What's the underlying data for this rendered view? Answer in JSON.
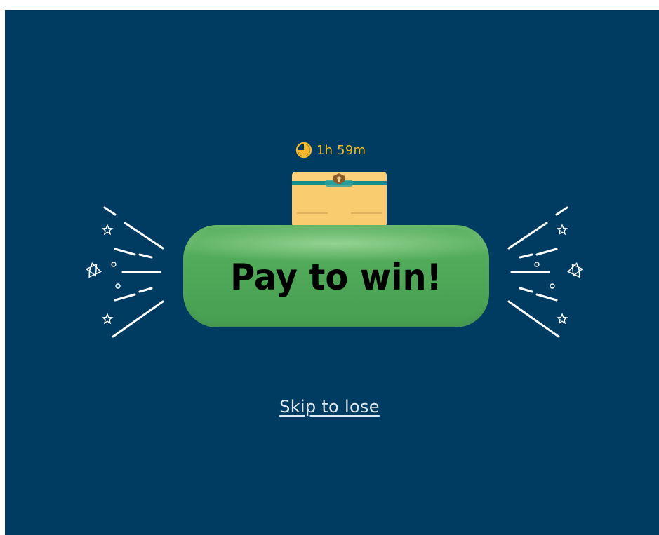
{
  "timer": {
    "icon": "pie-clock-icon",
    "text": "1h 59m",
    "color": "#f5b82a"
  },
  "chest": {
    "icon": "treasure-chest-icon",
    "color": "#f7c86a"
  },
  "offer": {
    "button_label": "Pay to win!",
    "button_color": "#4ca656"
  },
  "decorations": {
    "left_icons": [
      "diamond-icon",
      "star-icon",
      "circle-icon"
    ],
    "right_icons": [
      "diamond-icon",
      "star-icon",
      "circle-icon"
    ]
  },
  "footer": {
    "skip_label": "Skip to lose"
  },
  "colors": {
    "background": "#003c61",
    "accent": "#f5b82a",
    "link": "#dfe8ef"
  }
}
